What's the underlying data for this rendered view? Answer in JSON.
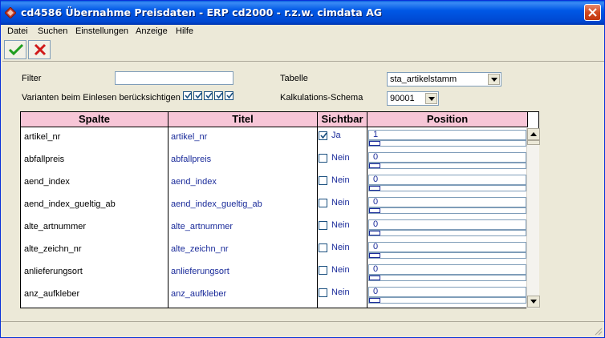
{
  "window": {
    "title": "cd4586 Übernahme Preisdaten - ERP cd2000 - r.z.w. cimdata AG"
  },
  "menu": {
    "items": [
      "Datei",
      "Suchen",
      "Einstellungen",
      "Anzeige",
      "Hilfe"
    ]
  },
  "form": {
    "filter_label": "Filter",
    "filter_value": "",
    "varianten_label": "Varianten beim Einlesen berücksichtigen",
    "tabelle_label": "Tabelle",
    "tabelle_value": "sta_artikelstamm",
    "kalk_label": "Kalkulations-Schema",
    "kalk_value": "90001"
  },
  "grid": {
    "headers": {
      "spalte": "Spalte",
      "titel": "Titel",
      "sichtbar": "Sichtbar",
      "position": "Position"
    },
    "rows": [
      {
        "spalte": "artikel_nr",
        "titel": "artikel_nr",
        "sichtbar": "Ja",
        "checked": true,
        "position": "1"
      },
      {
        "spalte": "abfallpreis",
        "titel": "abfallpreis",
        "sichtbar": "Nein",
        "checked": false,
        "position": "0"
      },
      {
        "spalte": "aend_index",
        "titel": "aend_index",
        "sichtbar": "Nein",
        "checked": false,
        "position": "0"
      },
      {
        "spalte": "aend_index_gueltig_ab",
        "titel": "aend_index_gueltig_ab",
        "sichtbar": "Nein",
        "checked": false,
        "position": "0"
      },
      {
        "spalte": "alte_artnummer",
        "titel": "alte_artnummer",
        "sichtbar": "Nein",
        "checked": false,
        "position": "0"
      },
      {
        "spalte": "alte_zeichn_nr",
        "titel": "alte_zeichn_nr",
        "sichtbar": "Nein",
        "checked": false,
        "position": "0"
      },
      {
        "spalte": "anlieferungsort",
        "titel": "anlieferungsort",
        "sichtbar": "Nein",
        "checked": false,
        "position": "0"
      },
      {
        "spalte": "anz_aufkleber",
        "titel": "anz_aufkleber",
        "sichtbar": "Nein",
        "checked": false,
        "position": "0"
      }
    ]
  },
  "icons": {
    "app": "diamond-app-icon",
    "confirm": "green-check-icon",
    "cancel": "red-x-icon",
    "close": "close-icon"
  },
  "colors": {
    "titlebar": "#0058e6",
    "grid_header": "#f7c6d7",
    "value_text": "#1a2b9a"
  }
}
